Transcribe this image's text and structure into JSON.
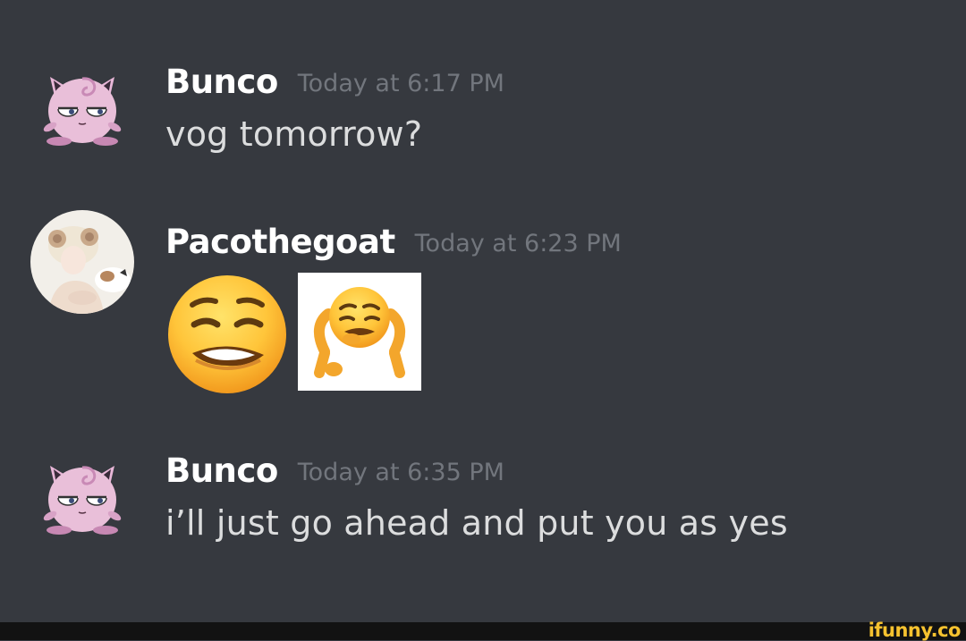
{
  "messages": [
    {
      "username": "Bunco",
      "timestamp": "Today at 6:17 PM",
      "text": "vog tomorrow?",
      "avatar_icon": "jigglypuff-avatar-icon"
    },
    {
      "username": "Pacothegoat",
      "timestamp": "Today at 6:23 PM",
      "emojis": [
        "lip-biting-emoji",
        "lip-biting-sticker"
      ],
      "avatar_icon": "anime-character-avatar-icon"
    },
    {
      "username": "Bunco",
      "timestamp": "Today at 6:35 PM",
      "text": "i’ll just go ahead and put you as yes",
      "avatar_icon": "jigglypuff-avatar-icon"
    }
  ],
  "watermark": {
    "text": "ifunny.co",
    "color": "#f6c22f"
  },
  "colors": {
    "background": "#36393f",
    "username": "#ffffff",
    "timestamp": "#72767d",
    "message_text": "#dcddde"
  }
}
